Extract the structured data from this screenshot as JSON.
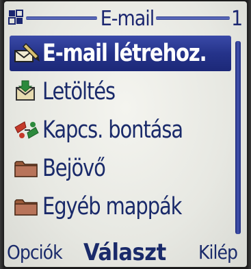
{
  "header": {
    "title": "E-mail",
    "page_indicator": "1",
    "icon": "grid-app-icon"
  },
  "menu": {
    "selected_index": 0,
    "items": [
      {
        "label": "E-mail létrehoz.",
        "icon": "compose-email-icon"
      },
      {
        "label": "Letöltés",
        "icon": "download-email-icon"
      },
      {
        "label": "Kapcs. bontása",
        "icon": "disconnect-icon"
      },
      {
        "label": "Bejövő",
        "icon": "folder-icon"
      },
      {
        "label": "Egyéb mappák",
        "icon": "folder-icon"
      }
    ]
  },
  "softkeys": {
    "left": "Opciók",
    "middle": "Választ",
    "right": "Kilép"
  },
  "colors": {
    "text": "#1a2a6a",
    "highlight": "#25338a",
    "background": "#eeeee8"
  }
}
